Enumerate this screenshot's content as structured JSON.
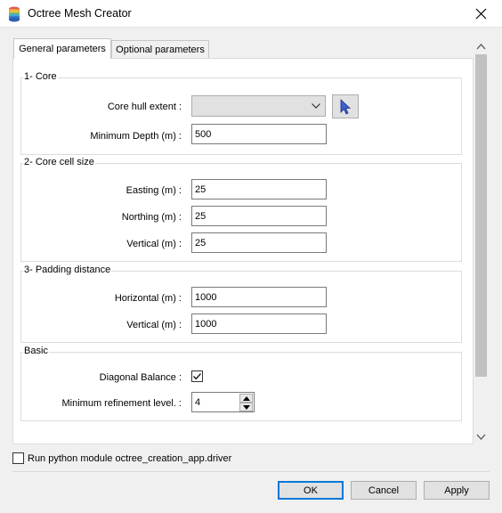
{
  "window": {
    "title": "Octree Mesh Creator"
  },
  "tabs": [
    {
      "label": "General parameters",
      "active": true
    },
    {
      "label": "Optional parameters",
      "active": false
    }
  ],
  "core": {
    "title": "1- Core",
    "hull_label": "Core hull extent :",
    "hull_value": "",
    "depth_label": "Minimum Depth (m) :",
    "depth_value": "500"
  },
  "cell": {
    "title": "2- Core cell size",
    "easting_label": "Easting (m) :",
    "easting_value": "25",
    "northing_label": "Northing (m) :",
    "northing_value": "25",
    "vertical_label": "Vertical (m) :",
    "vertical_value": "25"
  },
  "padding": {
    "title": "3- Padding distance",
    "horizontal_label": "Horizontal (m) :",
    "horizontal_value": "1000",
    "vertical_label": "Vertical (m) :",
    "vertical_value": "1000"
  },
  "basic": {
    "title": "Basic",
    "diag_label": "Diagonal Balance :",
    "diag_checked": true,
    "refine_label": "Minimum refinement level. :",
    "refine_value": "4"
  },
  "footer": {
    "run_label": "Run python module octree_creation_app.driver",
    "run_checked": false,
    "ok": "OK",
    "cancel": "Cancel",
    "apply": "Apply"
  },
  "colors": {
    "accent": "#0078d7",
    "icon_blue": "#3a63d6"
  },
  "icons": {
    "app": "database-stack-icon",
    "close": "close-icon",
    "dropdown": "chevron-down-icon",
    "pick": "cursor-arrow-icon",
    "check": "checkmark-icon"
  }
}
